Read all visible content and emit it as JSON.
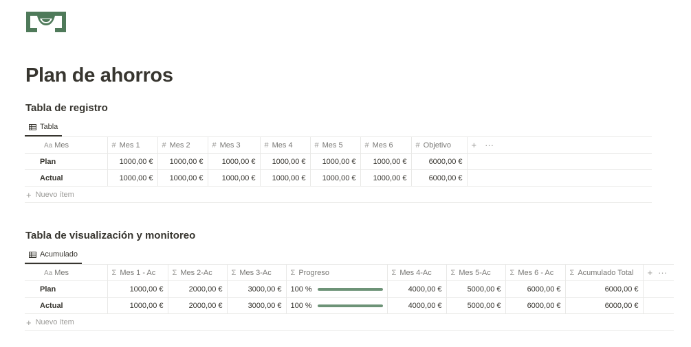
{
  "page": {
    "title": "Plan de ahorros",
    "icon": "money-bill-icon",
    "icon_color": "#4f7a5a"
  },
  "sections": {
    "registro": {
      "heading": "Tabla de registro",
      "view_tab": "Tabla",
      "columns": [
        {
          "symbol": "Aa",
          "label": "Mes"
        },
        {
          "symbol": "#",
          "label": "Mes 1"
        },
        {
          "symbol": "#",
          "label": "Mes 2"
        },
        {
          "symbol": "#",
          "label": "Mes 3"
        },
        {
          "symbol": "#",
          "label": "Mes 4"
        },
        {
          "symbol": "#",
          "label": "Mes 5"
        },
        {
          "symbol": "#",
          "label": "Mes 6"
        },
        {
          "symbol": "#",
          "label": "Objetivo"
        }
      ],
      "rows": [
        {
          "name": "Plan",
          "cells": [
            "1000,00 €",
            "1000,00 €",
            "1000,00 €",
            "1000,00 €",
            "1000,00 €",
            "1000,00 €",
            "6000,00 €"
          ]
        },
        {
          "name": "Actual",
          "cells": [
            "1000,00 €",
            "1000,00 €",
            "1000,00 €",
            "1000,00 €",
            "1000,00 €",
            "1000,00 €",
            "6000,00 €"
          ]
        }
      ],
      "add_column": "+",
      "more": "···",
      "new_item": "Nuevo ítem"
    },
    "monitoreo": {
      "heading": "Tabla de visualización y monitoreo",
      "view_tab": "Acumulado",
      "columns": [
        {
          "symbol": "Aa",
          "label": "Mes"
        },
        {
          "symbol": "Σ",
          "label": "Mes 1 - Ac"
        },
        {
          "symbol": "Σ",
          "label": "Mes 2-Ac"
        },
        {
          "symbol": "Σ",
          "label": "Mes 3-Ac"
        },
        {
          "symbol": "Σ",
          "label": "Progreso"
        },
        {
          "symbol": "Σ",
          "label": "Mes 4-Ac"
        },
        {
          "symbol": "Σ",
          "label": "Mes 5-Ac"
        },
        {
          "symbol": "Σ",
          "label": "Mes 6 - Ac"
        },
        {
          "symbol": "Σ",
          "label": "Acumulado Total"
        }
      ],
      "rows": [
        {
          "name": "Plan",
          "cells_a": [
            "1000,00 €",
            "2000,00 €",
            "3000,00 €"
          ],
          "progress_label": "100 %",
          "progress_fraction": 1.0,
          "cells_b": [
            "4000,00 €",
            "5000,00 €",
            "6000,00 €",
            "6000,00 €"
          ]
        },
        {
          "name": "Actual",
          "cells_a": [
            "1000,00 €",
            "2000,00 €",
            "3000,00 €"
          ],
          "progress_label": "100 %",
          "progress_fraction": 1.0,
          "cells_b": [
            "4000,00 €",
            "5000,00 €",
            "6000,00 €",
            "6000,00 €"
          ]
        }
      ],
      "progress_color": "#6d9377",
      "add_column": "+",
      "more": "···",
      "new_item": "Nuevo ítem"
    }
  }
}
